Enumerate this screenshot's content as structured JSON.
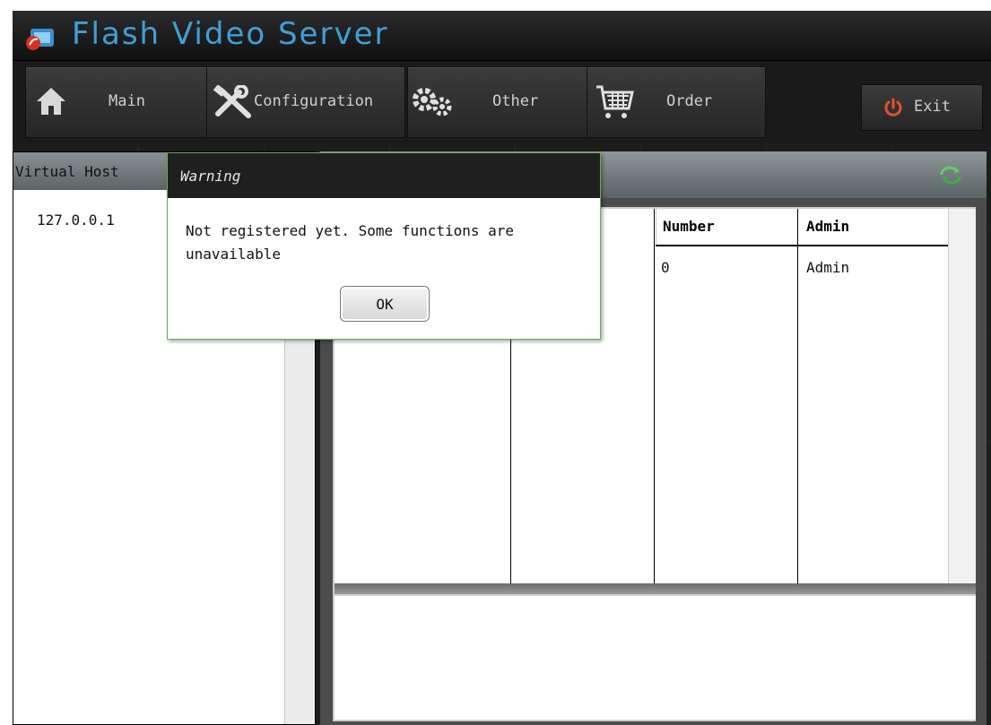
{
  "app": {
    "title": "Flash Video Server"
  },
  "toolbar": {
    "items": [
      {
        "label": "Main",
        "icon": "home-icon"
      },
      {
        "label": "Configuration",
        "icon": "tools-icon"
      },
      {
        "label": "Other",
        "icon": "gears-icon"
      },
      {
        "label": "Order",
        "icon": "cart-icon"
      }
    ],
    "exit_label": "Exit",
    "exit_icon": "power-icon"
  },
  "left_panel": {
    "header": "Virtual Host",
    "hosts": [
      "127.0.0.1"
    ]
  },
  "table": {
    "columns": [
      "Number",
      "Admin"
    ],
    "rows": [
      {
        "number": "0",
        "admin": "Admin"
      }
    ]
  },
  "refresh_icon": "refresh-icon",
  "dialog": {
    "title": "Warning",
    "message": "Not registered yet. Some functions are unavailable",
    "ok_label": "OK",
    "border_color": "#6ab04c"
  },
  "colors": {
    "title_text": "#3ea0d8",
    "background": "#1d1d1d",
    "exit_icon": "#e5502e"
  }
}
